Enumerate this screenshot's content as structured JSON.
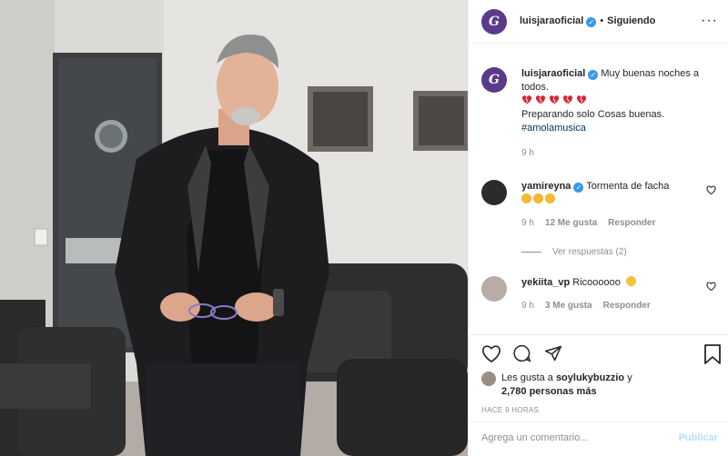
{
  "header": {
    "avatar_letter": "G",
    "username": "luisjaraoficial",
    "separator": "•",
    "follow_status": "Siguiendo",
    "more": "···"
  },
  "caption": {
    "username": "luisjaraoficial",
    "line1": "Muy buenas noches a todos.",
    "hearts_count": 5,
    "line2": "Preparando solo Cosas buenas.",
    "hashtag": "#amolamusica",
    "time": "9 h"
  },
  "comments": [
    {
      "username": "yamireyna",
      "text": "Tormenta de facha",
      "emoji": "clapping-hands",
      "emoji_count": 3,
      "time": "9 h",
      "likes": "12 Me gusta",
      "reply": "Responder",
      "view_replies": "Ver respuestas (2)"
    },
    {
      "username": "yekiita_vp",
      "text": "Ricoooooo",
      "emoji": "face-savoring-food",
      "time": "9 h",
      "likes": "3 Me gusta",
      "reply": "Responder"
    }
  ],
  "likes": {
    "prefix": "Les gusta a",
    "user": "soylukybuzzio",
    "suffix": "y",
    "count": "2,780 personas más"
  },
  "posted_ago": "HACE 9 HORAS",
  "add_comment": {
    "placeholder": "Agrega un comentario...",
    "publish": "Publicar"
  },
  "colors": {
    "link": "#00376b",
    "verified": "#3897f0",
    "publish_disabled": "#b2dffc",
    "secondary_text": "#8e8e8e",
    "heart_red": "#d72638",
    "avatar_purple": "#5b3a8c"
  }
}
